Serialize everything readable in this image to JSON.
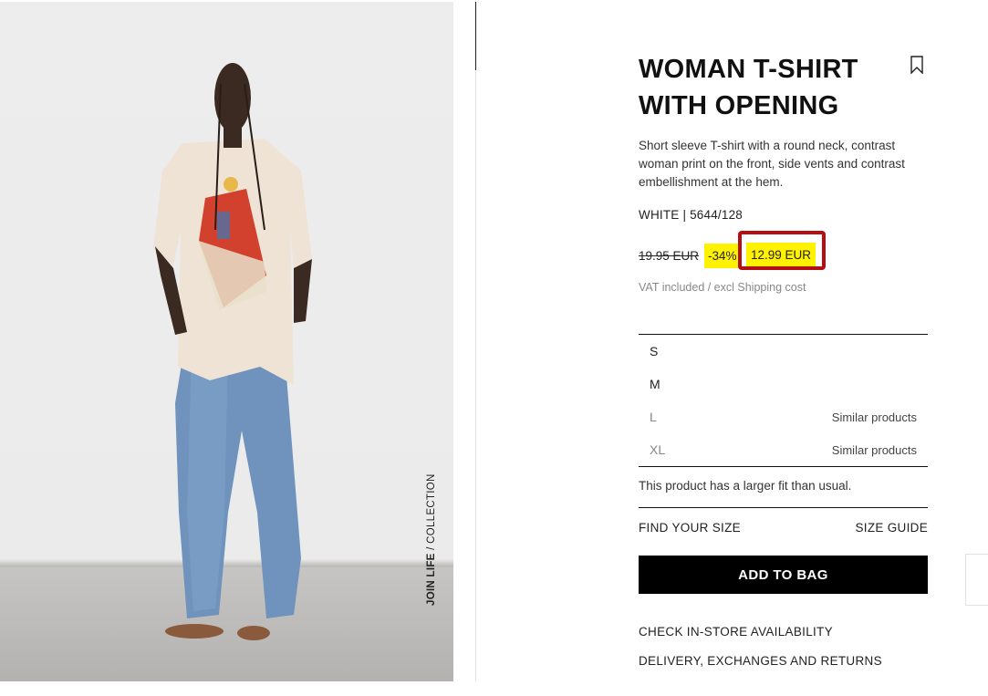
{
  "product": {
    "title_line1": "WOMAN T-SHIRT",
    "title_line2": "WITH OPENING",
    "description": "Short sleeve T-shirt with a round neck, contrast woman print on the front, side vents and contrast embellishment at the hem.",
    "color_ref": "WHITE | 5644/128",
    "old_price": "19.95 EUR",
    "discount": "-34%",
    "new_price": "12.99 EUR",
    "vat_note": "VAT included / excl Shipping cost"
  },
  "image": {
    "collection_bold": "JOIN LIFE",
    "collection_rest": " / COLLECTION"
  },
  "sizes": [
    {
      "label": "S",
      "note": ""
    },
    {
      "label": "M",
      "note": ""
    },
    {
      "label": "L",
      "note": "Similar products"
    },
    {
      "label": "XL",
      "note": "Similar products"
    }
  ],
  "fit_note": "This product has a larger fit than usual.",
  "actions": {
    "find_size": "FIND YOUR SIZE",
    "size_guide": "SIZE GUIDE",
    "add_to_bag": "ADD TO BAG",
    "check_store": "CHECK IN-STORE AVAILABILITY",
    "delivery": "DELIVERY, EXCHANGES AND RETURNS"
  },
  "icons": {
    "bookmark": "bookmark-icon"
  },
  "colors": {
    "highlight": "#fff200",
    "annotation_box": "#b50f14",
    "button_bg": "#000000"
  }
}
